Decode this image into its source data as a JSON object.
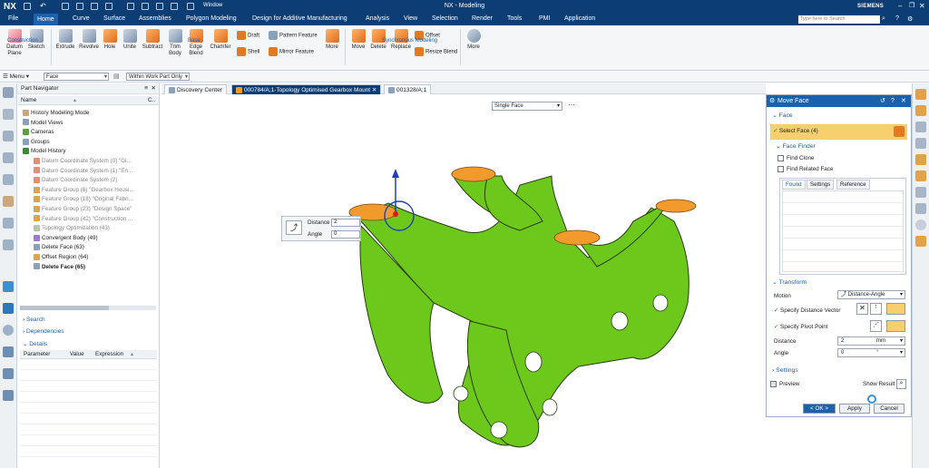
{
  "app": {
    "logo": "NX",
    "title": "NX - Modeling",
    "brand": "SIEMENS",
    "window_menu": "Window"
  },
  "menu_tabs": [
    "File",
    "Home",
    "Curve",
    "Surface",
    "Assemblies",
    "Polygon Modeling",
    "Design for Additive Manufacturing",
    "Analysis",
    "View",
    "Selection",
    "Render",
    "Tools",
    "PMI",
    "Application"
  ],
  "search_placeholder": "Type here to Search",
  "ribbon": {
    "construction": {
      "datum": "Datum\nPlane",
      "sketch": "Sketch",
      "label": "Construction"
    },
    "base": {
      "extrude": "Extrude",
      "revolve": "Revolve",
      "hole": "Hole",
      "unite": "Unite",
      "subtract": "Subtract",
      "trim": "Trim\nBody",
      "edge": "Edge\nBlend",
      "chamfer": "Chamfer",
      "draft": "Draft",
      "pattern": "Pattern Feature",
      "shell": "Shell",
      "mirror": "Mirror Feature",
      "more": "More",
      "label": "Base"
    },
    "sync": {
      "move": "Move",
      "delete": "Delete",
      "replace": "Replace",
      "offset": "Offset",
      "resize": "Resize Blend",
      "label": "Synchronous Modeling"
    },
    "more2": "More"
  },
  "selection_bar": {
    "menu": "Menu",
    "filter": "Face",
    "scope": "Within Work Part Only"
  },
  "part_navigator": {
    "title": "Part Navigator",
    "col_name": "Name",
    "col_c": "C..",
    "rows": [
      {
        "text": "History Modeling Mode",
        "style": "normal",
        "indent": 1
      },
      {
        "text": "Model Views",
        "style": "normal",
        "indent": 1
      },
      {
        "text": "Cameras",
        "style": "normal",
        "indent": 1
      },
      {
        "text": "Groups",
        "style": "normal",
        "indent": 1
      },
      {
        "text": "Model History",
        "style": "normal",
        "indent": 1
      },
      {
        "text": "Datum Coordinate System (0) \"Gl...",
        "style": "gray",
        "indent": 2
      },
      {
        "text": "Datum Coordinate System (1) \"En...",
        "style": "gray",
        "indent": 2
      },
      {
        "text": "Datum Coordinate System (2)",
        "style": "gray",
        "indent": 2
      },
      {
        "text": "Feature Group (6) \"Gearbox Housi...",
        "style": "gray",
        "indent": 2
      },
      {
        "text": "Feature Group (18) \"Original Fabri...",
        "style": "gray",
        "indent": 2
      },
      {
        "text": "Feature Group (23) \"Design Space\"",
        "style": "gray",
        "indent": 2
      },
      {
        "text": "Feature Group (42) \"Construction ...",
        "style": "gray",
        "indent": 2
      },
      {
        "text": "Topology Optimization (43)",
        "style": "gray",
        "indent": 2
      },
      {
        "text": "Convergent Body (49)",
        "style": "normal",
        "indent": 2
      },
      {
        "text": "Delete Face (63)",
        "style": "normal",
        "indent": 2
      },
      {
        "text": "Offset Region (64)",
        "style": "normal",
        "indent": 2
      },
      {
        "text": "Delete Face (65)",
        "style": "bold",
        "indent": 2
      }
    ],
    "sections": {
      "search": "Search",
      "dependencies": "Dependencies",
      "details": "Details"
    },
    "details_cols": [
      "Parameter",
      "Value",
      "Expression"
    ]
  },
  "doc_tabs": [
    "Discovery Center",
    "000784/A;1-Topology Optimised Gearbox Mount",
    "001328/A;1"
  ],
  "viewport": {
    "face_option": "Single Face",
    "dots": "···",
    "distance_label": "Distance",
    "distance_value": "2",
    "angle_label": "Angle",
    "angle_value": "0"
  },
  "move_face": {
    "title": "Move Face",
    "face_section": "Face",
    "select_face": "Select Face (4)",
    "face_finder": "Face Finder",
    "find_clone": "Find Clone",
    "find_related": "Find Related Face",
    "finder_tabs": [
      "Found",
      "Settings",
      "Reference"
    ],
    "transform_section": "Transform",
    "motion_label": "Motion",
    "motion_value": "Distance-Angle",
    "distance_vector": "Specify Distance Vector",
    "pivot_point": "Specify Pivot Point",
    "distance_label": "Distance",
    "distance_value": "2",
    "distance_unit": "mm",
    "angle_label": "Angle",
    "angle_value": "0",
    "angle_unit": "°",
    "settings_section": "Settings",
    "preview": "Preview",
    "show_result": "Show Result",
    "ok": "< OK >",
    "apply": "Apply",
    "cancel": "Cancel"
  },
  "colors": {
    "title_bar": "#0c3d74",
    "accent": "#1d61ad",
    "model_green": "#6cc81a",
    "face_orange": "#f39a2c"
  }
}
